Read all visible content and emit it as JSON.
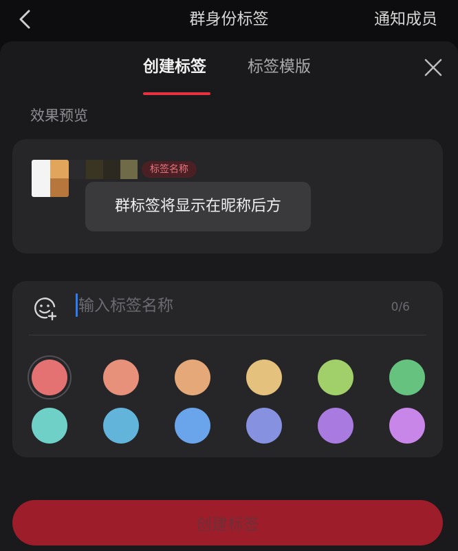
{
  "header": {
    "title": "群身份标签",
    "right_action": "通知成员"
  },
  "tabs": [
    {
      "label": "创建标签",
      "active": true
    },
    {
      "label": "标签模版",
      "active": false
    }
  ],
  "preview": {
    "section_title": "效果预览",
    "tag_chip": "标签名称",
    "tooltip": "群标签将显示在昵称后方"
  },
  "input": {
    "placeholder": "输入标签名称",
    "value": "",
    "counter": "0/6"
  },
  "colors": [
    "#e57272",
    "#e8917a",
    "#e5a878",
    "#e4c17c",
    "#a1cf6a",
    "#66c37f",
    "#6ed0c7",
    "#63b4da",
    "#6aa4ea",
    "#8691e0",
    "#a97be0",
    "#c886e9"
  ],
  "selected_color_index": 0,
  "primary_button": {
    "label": "创建标签"
  },
  "theme": {
    "accent": "#e8323f",
    "button_bg": "#9e1d2b"
  }
}
